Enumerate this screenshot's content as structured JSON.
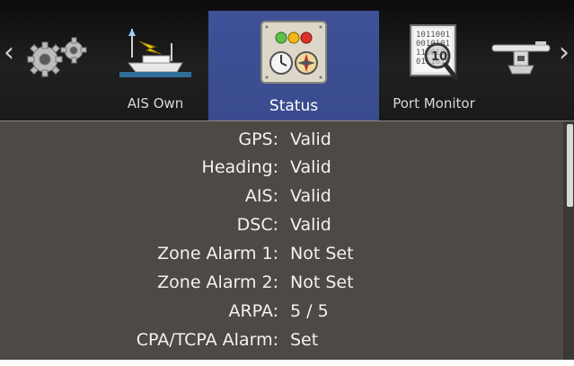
{
  "nav": {
    "tabs": [
      {
        "label": "",
        "icon": "settings-gears-icon"
      },
      {
        "label": "AIS Own",
        "icon": "ais-own-ship-icon"
      },
      {
        "label": "Status",
        "icon": "status-panel-icon"
      },
      {
        "label": "Port Monitor",
        "icon": "port-monitor-icon"
      },
      {
        "label": "",
        "icon": "radar-antenna-icon"
      }
    ],
    "active_tab": "Status",
    "left_arrow": "‹",
    "right_arrow": "›"
  },
  "status": {
    "rows": [
      {
        "key": "GPS:",
        "value": "Valid"
      },
      {
        "key": "Heading:",
        "value": "Valid"
      },
      {
        "key": "AIS:",
        "value": "Valid"
      },
      {
        "key": "DSC:",
        "value": "Valid"
      },
      {
        "key": "Zone Alarm 1:",
        "value": "Not Set"
      },
      {
        "key": "Zone Alarm 2:",
        "value": "Not Set"
      },
      {
        "key": "ARPA:",
        "value": "5 / 5"
      },
      {
        "key": "CPA/TCPA Alarm:",
        "value": "Set"
      }
    ]
  },
  "colors": {
    "active_tab": "#3f5197",
    "panel_bg": "#4d4944",
    "text": "#f2f2f2"
  }
}
